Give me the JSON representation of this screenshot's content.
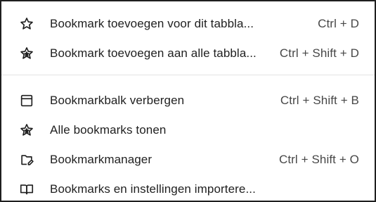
{
  "menu": {
    "items": [
      {
        "label": "Bookmark toevoegen voor dit tabbla...",
        "shortcut": "Ctrl + D",
        "icon": "star-outline-icon"
      },
      {
        "label": "Bookmark toevoegen aan alle tabbla...",
        "shortcut": "Ctrl + Shift + D",
        "icon": "stars-icon"
      },
      {
        "label": "Bookmarkbalk verbergen",
        "shortcut": "Ctrl + Shift + B",
        "icon": "bookmark-bar-window-icon"
      },
      {
        "label": "Alle bookmarks tonen",
        "shortcut": "",
        "icon": "stars-icon"
      },
      {
        "label": "Bookmarkmanager",
        "shortcut": "Ctrl + Shift + O",
        "icon": "folder-edit-icon"
      },
      {
        "label": "Bookmarks en instellingen importere...",
        "shortcut": "",
        "icon": "open-book-icon"
      }
    ]
  },
  "colors": {
    "text": "#1f1f1f",
    "shortcut_text": "#474747",
    "icon": "#1f1f1f",
    "separator": "#e3e3e3",
    "background": "#ffffff"
  }
}
